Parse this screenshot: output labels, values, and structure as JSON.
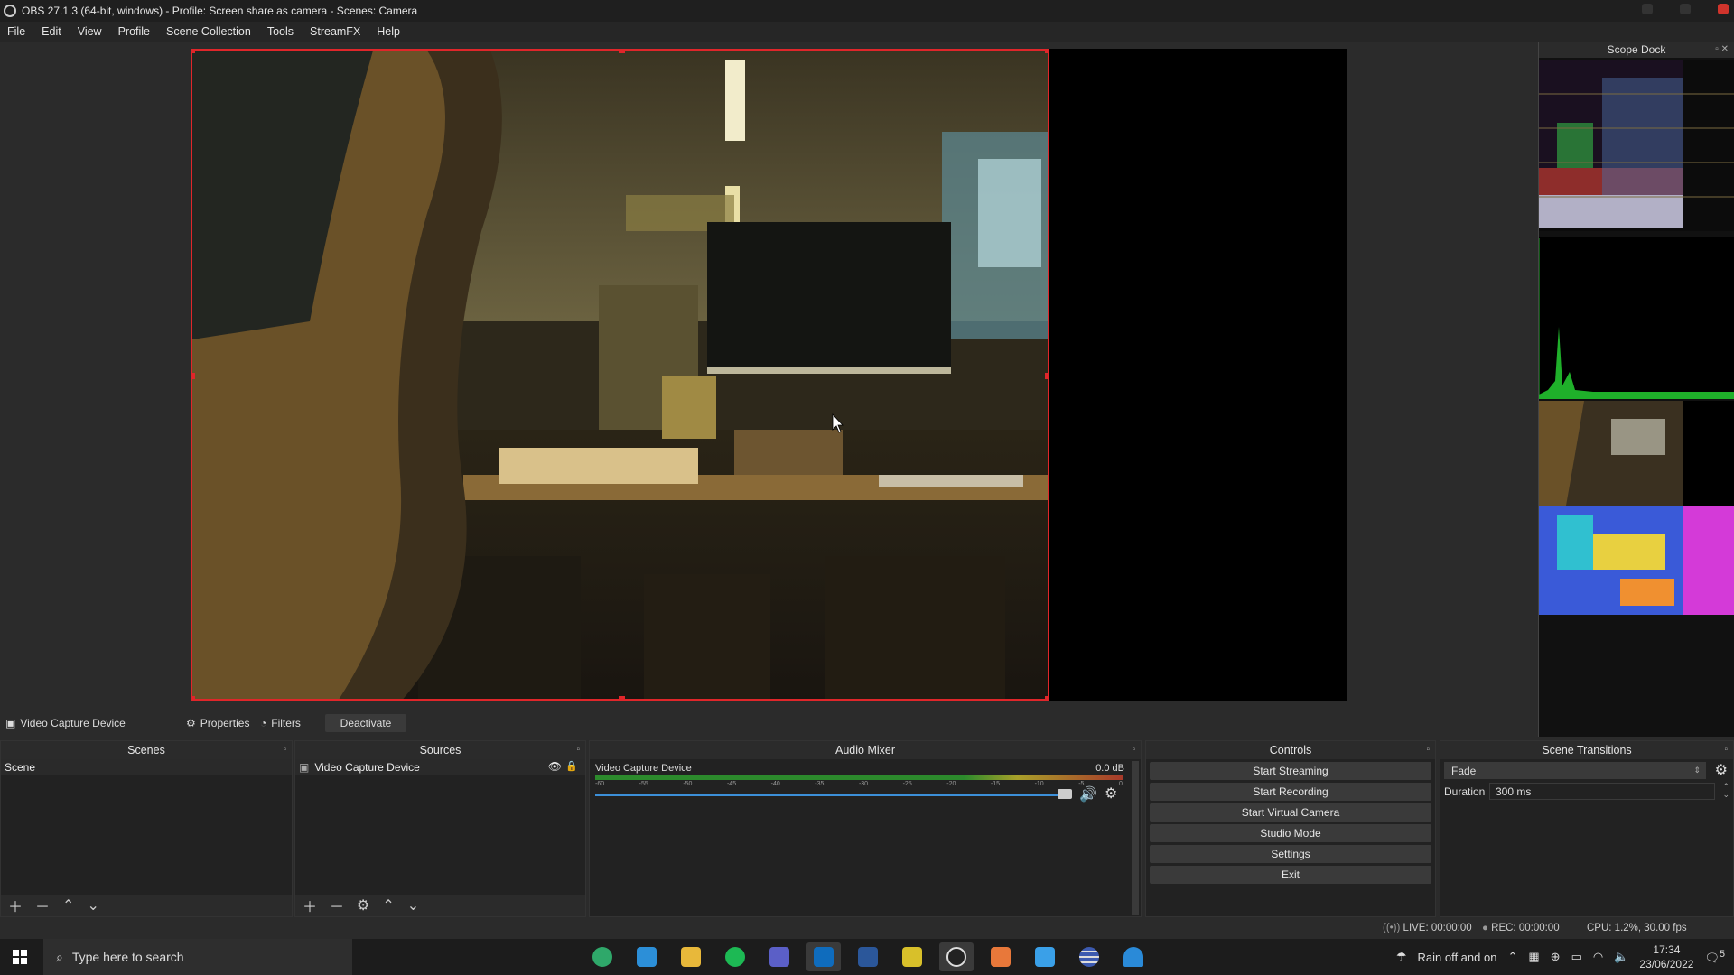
{
  "window": {
    "title": "OBS 27.1.3 (64-bit, windows) - Profile: Screen share as camera - Scenes: Camera"
  },
  "menu": [
    "File",
    "Edit",
    "View",
    "Profile",
    "Scene Collection",
    "Tools",
    "StreamFX",
    "Help"
  ],
  "scope_dock": {
    "title": "Scope Dock"
  },
  "source_toolbar": {
    "source_name": "Video Capture Device",
    "properties": "Properties",
    "filters": "Filters",
    "deactivate": "Deactivate"
  },
  "scenes": {
    "title": "Scenes",
    "items": [
      "Scene"
    ]
  },
  "sources": {
    "title": "Sources",
    "items": [
      "Video Capture Device"
    ]
  },
  "audio_mixer": {
    "title": "Audio Mixer",
    "channel": {
      "name": "Video Capture Device",
      "db": "0.0 dB",
      "volume": 1.0
    },
    "ticks": [
      "-60",
      "-55",
      "-50",
      "-45",
      "-40",
      "-35",
      "-30",
      "-25",
      "-20",
      "-15",
      "-10",
      "-5",
      "0"
    ]
  },
  "controls": {
    "title": "Controls",
    "buttons": [
      "Start Streaming",
      "Start Recording",
      "Start Virtual Camera",
      "Studio Mode",
      "Settings",
      "Exit"
    ]
  },
  "scene_transitions": {
    "title": "Scene Transitions",
    "transition": "Fade",
    "duration_label": "Duration",
    "duration": "300 ms"
  },
  "status": {
    "live": "LIVE: 00:00:00",
    "rec": "REC: 00:00:00",
    "cpu": "CPU: 1.2%, 30.00 fps"
  },
  "taskbar": {
    "search_placeholder": "Type here to search",
    "weather": "Rain off and on",
    "time": "17:34",
    "date": "23/06/2022",
    "notifications": "5",
    "app_icons": [
      "edge-dev-icon",
      "vscode-icon",
      "file-explorer-icon",
      "spotify-icon",
      "teams-icon",
      "outlook-icon",
      "word-icon",
      "bandicam-icon",
      "obs-icon",
      "app-orange-icon",
      "app-blue-icon",
      "app-striped-icon",
      "app-person-icon"
    ]
  },
  "colors": {
    "selection": "#e0262a",
    "accent_blue": "#3c8fd8"
  }
}
